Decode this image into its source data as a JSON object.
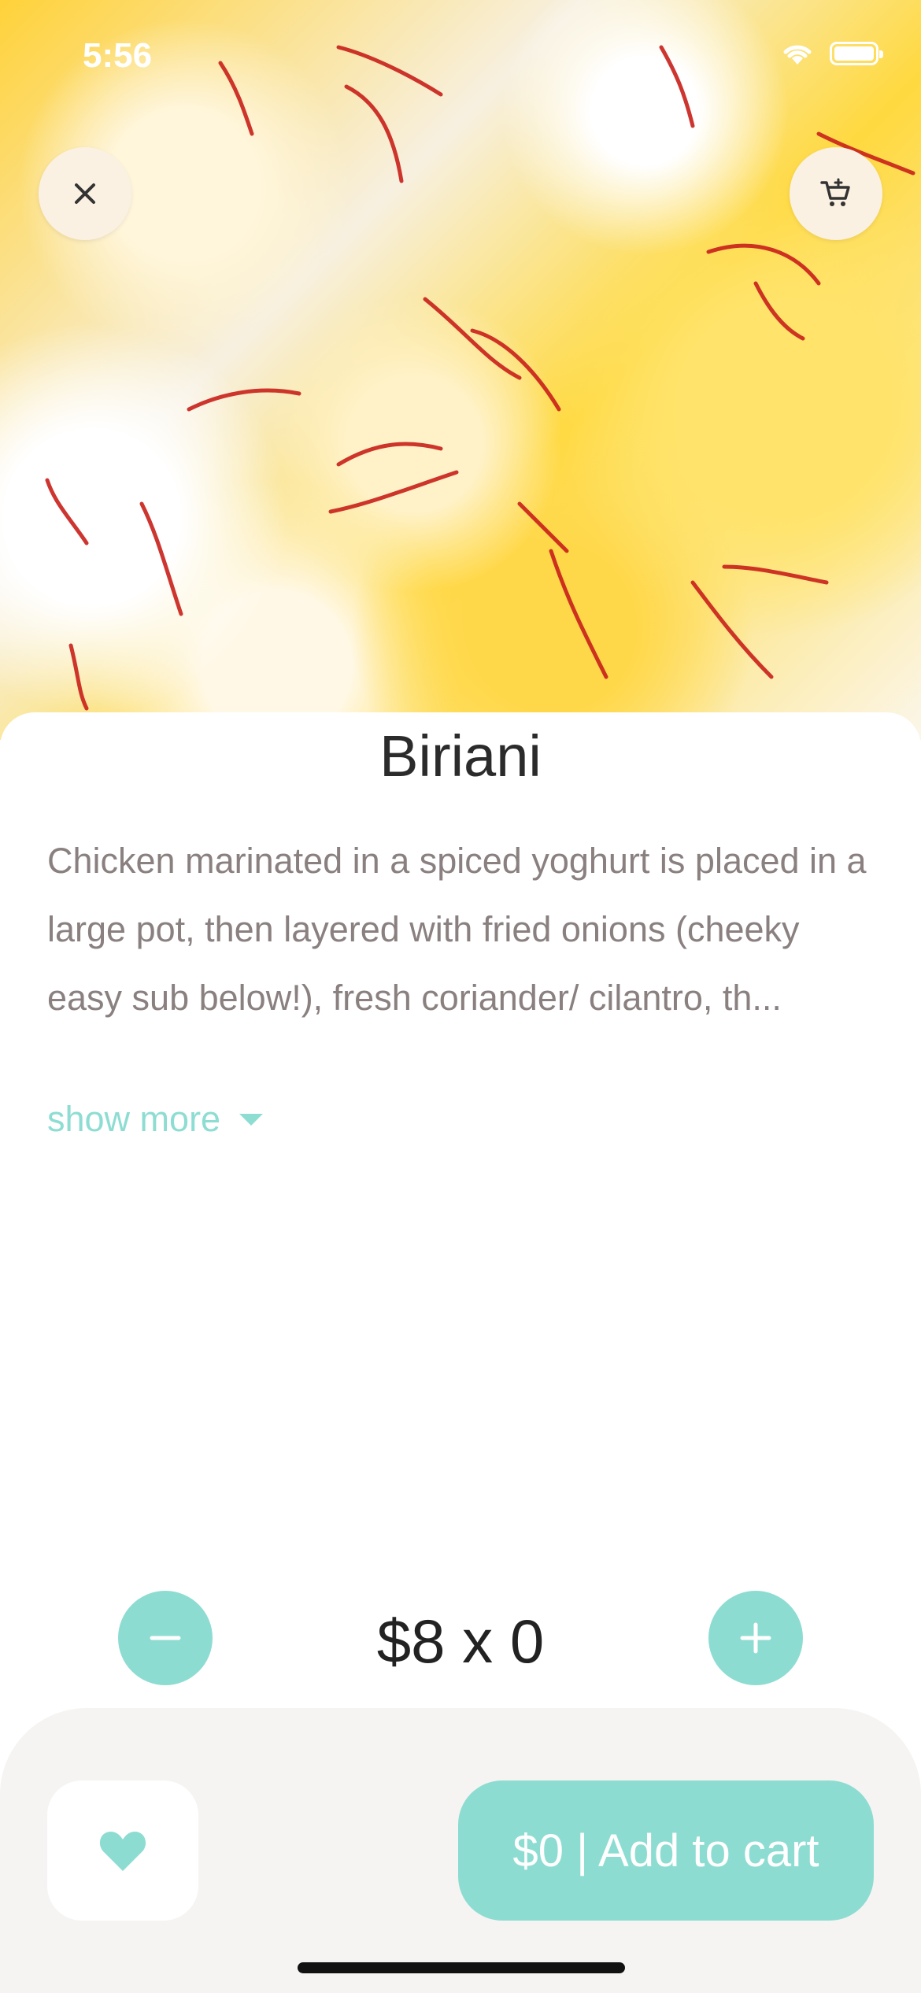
{
  "status": {
    "time": "5:56"
  },
  "icons": {
    "close": "close-icon",
    "cart": "cart-icon",
    "minus": "minus-icon",
    "plus": "plus-icon",
    "heart": "heart-icon",
    "wifi": "wifi-icon",
    "battery": "battery-icon",
    "caret": "caret-down-icon"
  },
  "product": {
    "title": "Biriani",
    "description": "Chicken marinated in a spiced yoghurt is placed in a large pot, then layered with fried onions (cheeky easy sub below!), fresh coriander/ cilantro, th...",
    "show_more": "show more",
    "price_qty": "$8 x 0"
  },
  "actions": {
    "add_to_cart": "$0 | Add to cart"
  },
  "colors": {
    "accent": "#8ddcd2",
    "sheet_bg": "#ffffff",
    "bottom_bar": "#f5f4f2",
    "round_btn": "#fbf1e3"
  }
}
